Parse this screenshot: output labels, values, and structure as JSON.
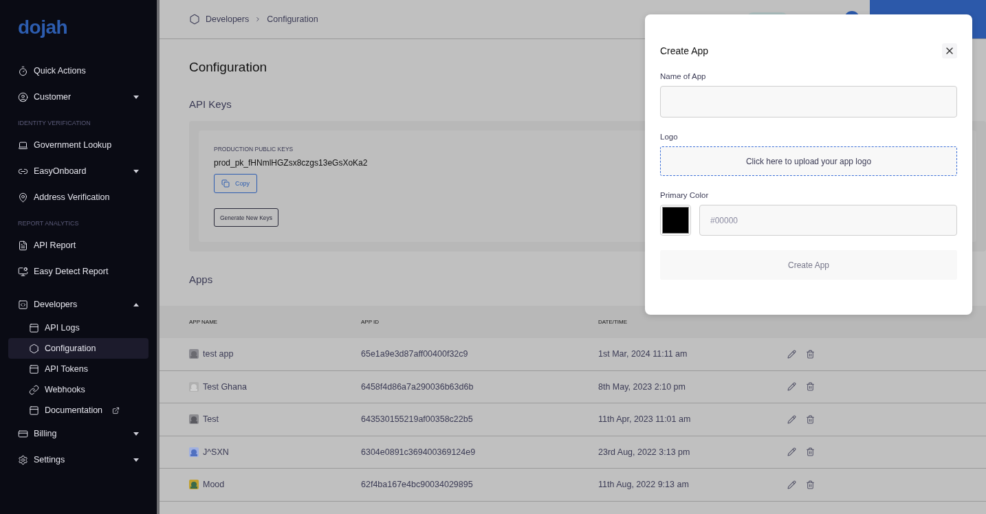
{
  "sidebar": {
    "logo": "dojah",
    "sections": [
      {
        "items": [
          {
            "label": "Quick Actions",
            "selected": false
          },
          {
            "label": "Customer",
            "selected": false,
            "expanded": false
          }
        ]
      },
      {
        "heading": "IDENTITY VERIFICATION",
        "items": [
          {
            "label": "Government Lookup",
            "selected": false
          },
          {
            "label": "EasyOnboard",
            "selected": false,
            "expanded": false
          },
          {
            "label": "Address Verification",
            "selected": false
          }
        ]
      },
      {
        "heading": "REPORT ANALYTICS",
        "items": [
          {
            "label": "API Report",
            "selected": false
          },
          {
            "label": "Easy Detect Report",
            "selected": false
          }
        ]
      },
      {
        "items": [
          {
            "label": "Developers",
            "selected": false,
            "expanded": true,
            "children": [
              {
                "label": "API Logs",
                "selected": false
              },
              {
                "label": "Configuration",
                "selected": true
              },
              {
                "label": "API Tokens",
                "selected": false
              },
              {
                "label": "Webhooks",
                "selected": false
              },
              {
                "label": "Documentation",
                "selected": false,
                "external": true
              }
            ]
          },
          {
            "label": "Billing",
            "selected": false,
            "expanded": false
          },
          {
            "label": "Settings",
            "selected": false,
            "expanded": false
          }
        ]
      }
    ]
  },
  "breadcrumb": [
    "Developers",
    "Configuration"
  ],
  "page_title": "Configuration",
  "api_keys": {
    "heading": "API Keys",
    "label": "PRODUCTION PUBLIC KEYS",
    "key": "prod_pk_fHNmlHGZsx8czgs13eGsXoKa2",
    "copy_button": "Copy",
    "generate_button": "Generate New Keys"
  },
  "apps": {
    "heading": "Apps",
    "columns": [
      "APP NAME",
      "APP ID",
      "DATE/TIME"
    ],
    "rows": [
      {
        "name": "test app",
        "id": "65e1a9e3d87aff00400f32c9",
        "date": "1st Mar, 2024 11:11 am"
      },
      {
        "name": "Test Ghana",
        "id": "6458f4d86a7a290036b63d6b",
        "date": "8th May, 2023 2:10 pm"
      },
      {
        "name": "Test",
        "id": "643530155219af00358c22b5",
        "date": "11th Apr, 2023 11:01 am"
      },
      {
        "name": "J^SXN",
        "id": "6304e0891c369400369124e9",
        "date": "23rd Aug, 2022 3:13 pm"
      },
      {
        "name": "Mood",
        "id": "62f4ba167e4bc90034029895",
        "date": "11th Aug, 2022 9:13 am"
      }
    ]
  },
  "modal": {
    "title": "Create App",
    "name_label": "Name of App",
    "logo_label": "Logo",
    "upload_text": "Click here to upload your app logo",
    "color_label": "Primary Color",
    "color": "#000000",
    "color_placeholder": "#00000",
    "submit": {
      "label": "Create App",
      "disabled": true
    }
  }
}
